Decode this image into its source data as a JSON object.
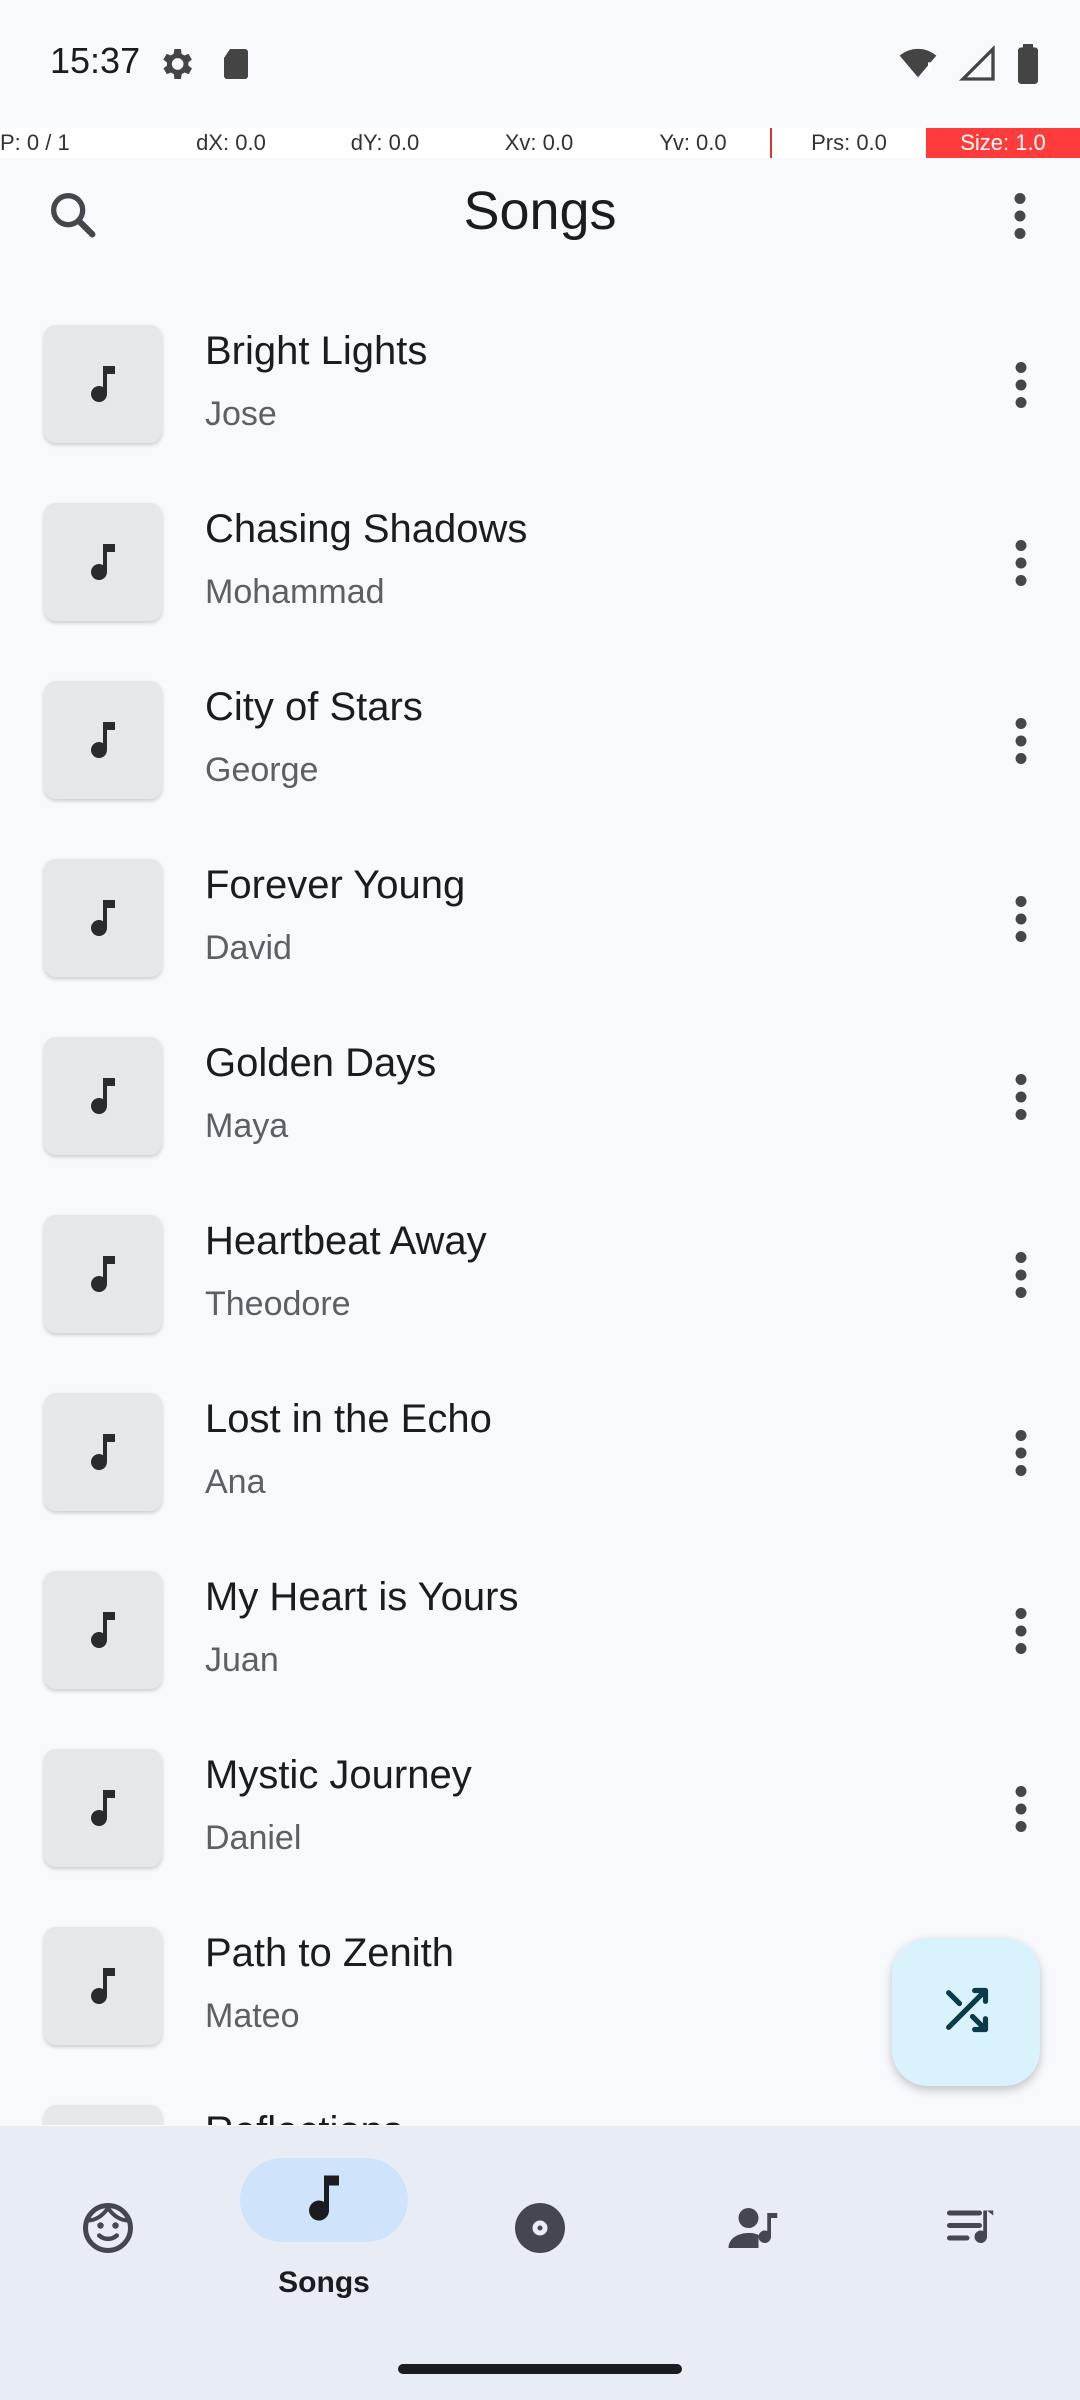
{
  "status_bar": {
    "time": "15:37",
    "icons": [
      "settings-gear-icon",
      "sd-card-icon",
      "wifi-alert-icon",
      "signal-icon",
      "battery-icon"
    ]
  },
  "debug": {
    "pointer": "P: 0 / 1",
    "dx": "dX: 0.0",
    "dy": "dY: 0.0",
    "xv": "Xv: 0.0",
    "yv": "Yv: 0.0",
    "prs": "Prs: 0.0",
    "size": "Size: 1.0"
  },
  "header": {
    "title": "Songs",
    "search_icon": "search-icon",
    "menu_icon": "more-vert-icon"
  },
  "songs": [
    {
      "title": "Bright Lights",
      "artist": "Jose"
    },
    {
      "title": "Chasing Shadows",
      "artist": "Mohammad"
    },
    {
      "title": "City of Stars",
      "artist": "George"
    },
    {
      "title": "Forever Young",
      "artist": "David"
    },
    {
      "title": "Golden Days",
      "artist": "Maya"
    },
    {
      "title": "Heartbeat Away",
      "artist": "Theodore"
    },
    {
      "title": "Lost in the Echo",
      "artist": "Ana"
    },
    {
      "title": "My Heart is Yours",
      "artist": "Juan"
    },
    {
      "title": "Mystic Journey",
      "artist": "Daniel"
    },
    {
      "title": "Path to Zenith",
      "artist": "Mateo"
    },
    {
      "title": "Reflections",
      "artist": ""
    }
  ],
  "fab": {
    "icon": "shuffle-icon"
  },
  "bottom_nav": {
    "items": [
      {
        "label": "",
        "icon": "face-icon"
      },
      {
        "label": "Songs",
        "icon": "music-note-icon",
        "active": true
      },
      {
        "label": "",
        "icon": "album-icon"
      },
      {
        "label": "",
        "icon": "artist-icon"
      },
      {
        "label": "",
        "icon": "playlist-icon"
      }
    ]
  },
  "colors": {
    "background": "#f8f9fd",
    "thumbnail": "#e6e7eb",
    "fab": "#d9f3fd",
    "nav_background": "#e8ecf5",
    "nav_active_pill": "#cfe4fb"
  }
}
